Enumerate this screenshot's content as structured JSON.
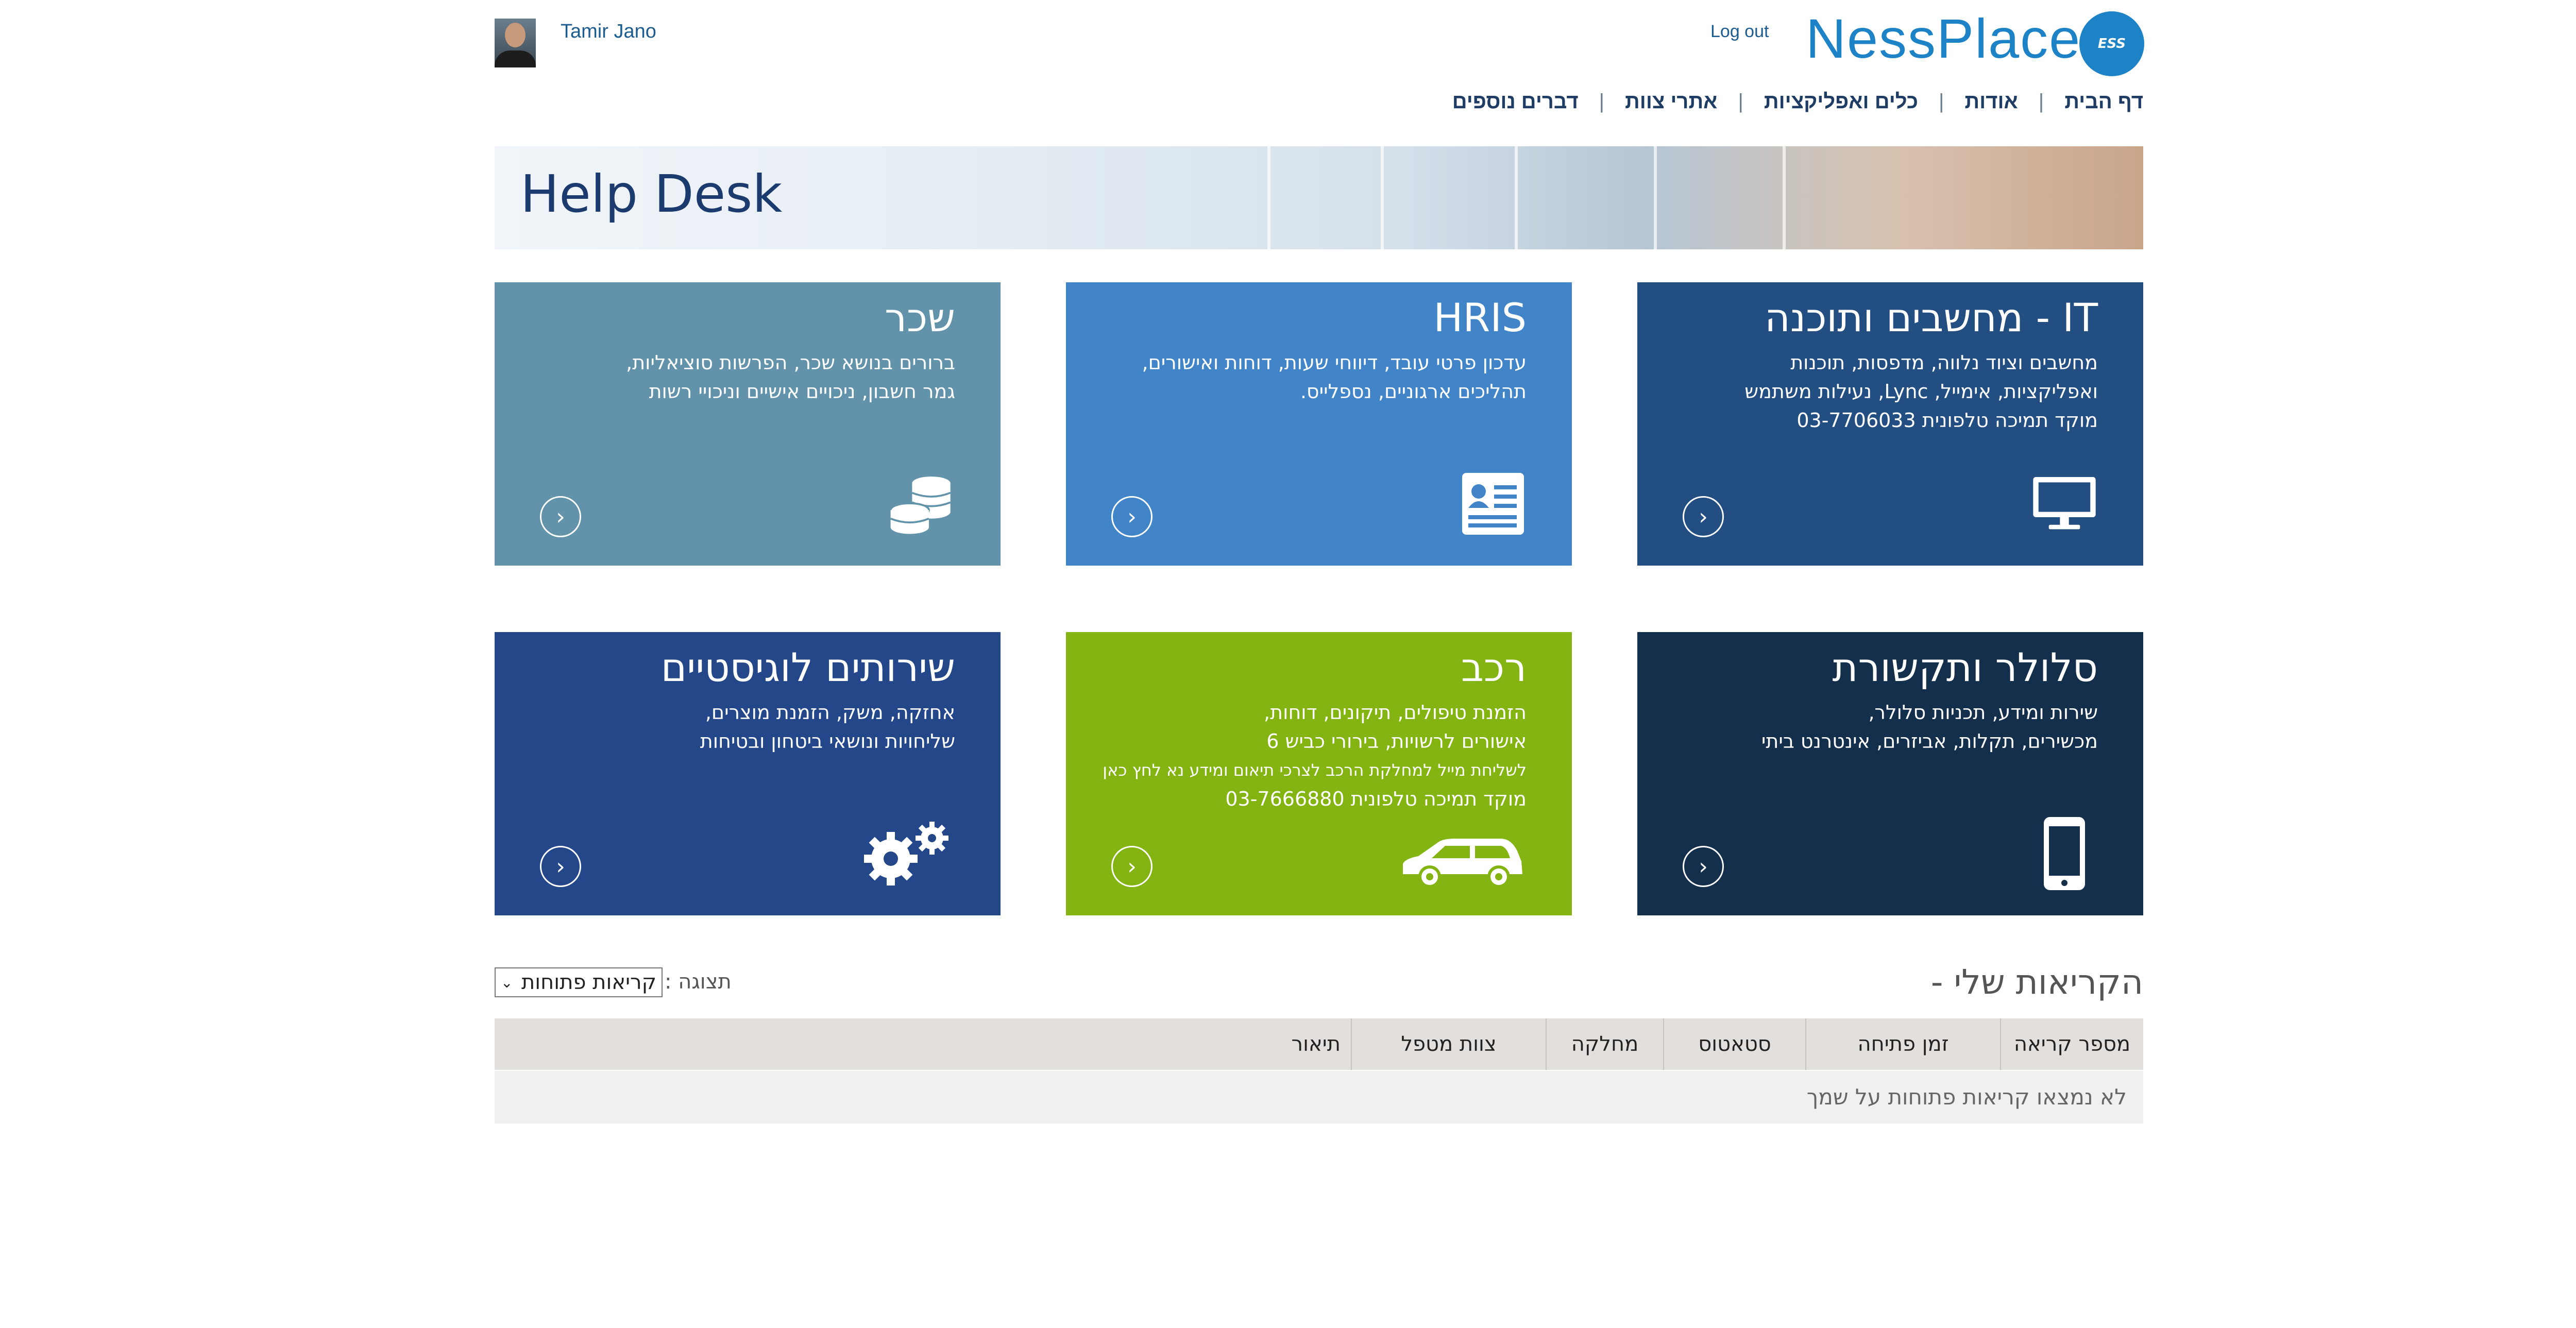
{
  "header": {
    "user_name": "Tamir Jano",
    "logout_label": "Log out",
    "logo_text": "NessPlace",
    "logo_badge": "ESS"
  },
  "nav": {
    "items": [
      "דף הבית",
      "אודות",
      "כלים ואפליקציות",
      "אתרי צוות",
      "דברים נוספים"
    ]
  },
  "banner": {
    "title": "Help Desk"
  },
  "tiles": [
    {
      "title": "IT - מחשבים ותוכנה",
      "lines": [
        "מחשבים וציוד נלווה, מדפסות, תוכנות",
        "ואפליקציות, אימייל, Lync, נעילות משתמש",
        "מוקד תמיכה טלפונית 03-7706033"
      ],
      "color": "#234e82",
      "icon": "monitor-icon"
    },
    {
      "title": "HRIS",
      "lines": [
        "עדכון פרטי עובד, דיווחי שעות, דוחות ואישורים,",
        "תהליכים ארגוניים, נספלייס."
      ],
      "color": "#4185c8",
      "icon": "id-card-icon"
    },
    {
      "title": "שכר",
      "lines": [
        "ברורים בנושא שכר, הפרשות סוציאליות,",
        "גמר חשבון, ניכויים אישיים וניכויי רשות"
      ],
      "color": "#6393aa",
      "icon": "coins-icon"
    },
    {
      "title": "סלולר ותקשורת",
      "lines": [
        "שירות ומידע, תכניות סלולר,",
        "מכשירים, תקלות, אביזרים, אינטרנט ביתי"
      ],
      "color": "#142f4c",
      "icon": "mobile-phone-icon"
    },
    {
      "title": "רכב",
      "lines": [
        "הזמנת טיפולים, תיקונים, דוחות,",
        "אישורים לרשויות, בירורי כביש 6"
      ],
      "small": "לשליחת מייל למחלקת הרכב לצרכי תיאום ומידע נא לחץ כאן",
      "phone": "מוקד תמיכה טלפונית 03-7666880",
      "color": "#84b411",
      "icon": "car-icon"
    },
    {
      "title": "שירותים לוגיסטיים",
      "lines": [
        "אחזקה, משק, הזמנת מוצרים,",
        "שליחויות ונושאי ביטחון ובטיחות"
      ],
      "color": "#24478a",
      "icon": "gears-icon"
    }
  ],
  "calls": {
    "title": "הקריאות שלי -",
    "view_label": "תצוגה :",
    "view_value": "קריאות פתוחות",
    "columns": [
      "מספר קריאה",
      "זמן פתיחה",
      "סטאטוס",
      "מחלקה",
      "צוות מטפל",
      "תיאור"
    ],
    "empty_message": "לא נמצאו קריאות פתוחות על שמך"
  }
}
